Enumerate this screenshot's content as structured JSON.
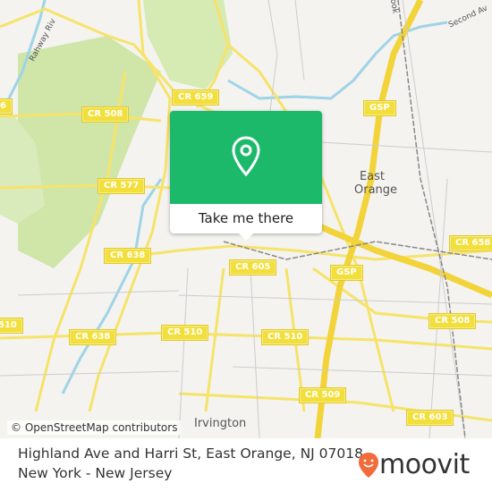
{
  "map": {
    "road_shields": [
      "CR 659",
      "CR 508",
      "GSP",
      "CR 577",
      "CR 638",
      "CR 605",
      "CR 658",
      "GSP",
      "CR 508",
      "CR 638",
      "CR 510",
      "CR 510",
      "CR 509",
      "CR 603",
      "510",
      "6"
    ],
    "places": [
      "East Orange",
      "Irvington"
    ],
    "street_labels": [
      "Rahway Riv",
      "Second Av",
      "ook"
    ],
    "attribution": "© OpenStreetMap contributors",
    "colors": {
      "road": "#f6e36a",
      "park": "#cfe6a8",
      "water": "#9fd3e8",
      "land": "#f4f3ef"
    }
  },
  "popup": {
    "button_label": "Take me there",
    "pin_icon": "map-pin-icon",
    "color": "#1db96a"
  },
  "footer": {
    "address_line1": "Highland Ave and Harri St, East Orange, NJ 07018,",
    "address_line2": "New York - New Jersey",
    "logo_text": "moovit",
    "logo_color": "#f26b3a"
  }
}
